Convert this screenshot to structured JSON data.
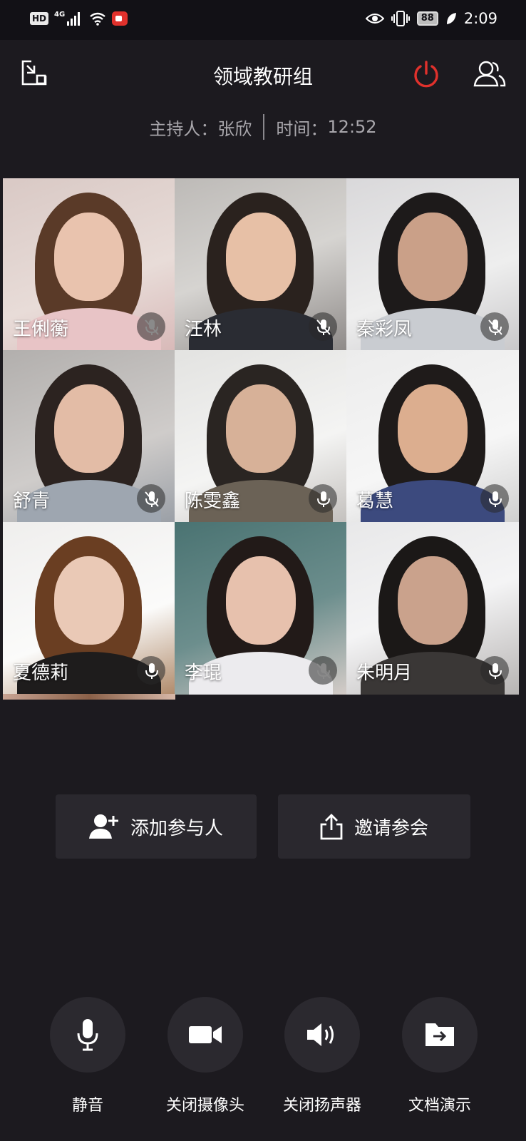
{
  "status_bar": {
    "hd": "HD",
    "network": "4G",
    "battery": "88",
    "time": "2:09"
  },
  "header": {
    "title": "领域教研组",
    "host_label": "主持人：",
    "host_name": "张欣",
    "time_label": "时间：",
    "time_value": "12:52"
  },
  "participants": [
    {
      "name": "王俐蘅",
      "mic": "muted-grey"
    },
    {
      "name": "汪林",
      "mic": "muted"
    },
    {
      "name": "秦彩凤",
      "mic": "muted"
    },
    {
      "name": "舒青",
      "mic": "muted"
    },
    {
      "name": "陈雯鑫",
      "mic": "on"
    },
    {
      "name": "葛慧",
      "mic": "on"
    },
    {
      "name": "夏德莉",
      "mic": "on"
    },
    {
      "name": "李琨",
      "mic": "muted-grey"
    },
    {
      "name": "朱明月",
      "mic": "on"
    }
  ],
  "actions": {
    "add_participants": "添加参与人",
    "invite": "邀请参会"
  },
  "controls": {
    "mute": "静音",
    "camera_off": "关闭摄像头",
    "speaker_off": "关闭扬声器",
    "doc_present": "文档演示"
  },
  "colors": {
    "background": "#1c1a1f",
    "power_red": "#e0312c",
    "button_bg": "#2a282e"
  }
}
